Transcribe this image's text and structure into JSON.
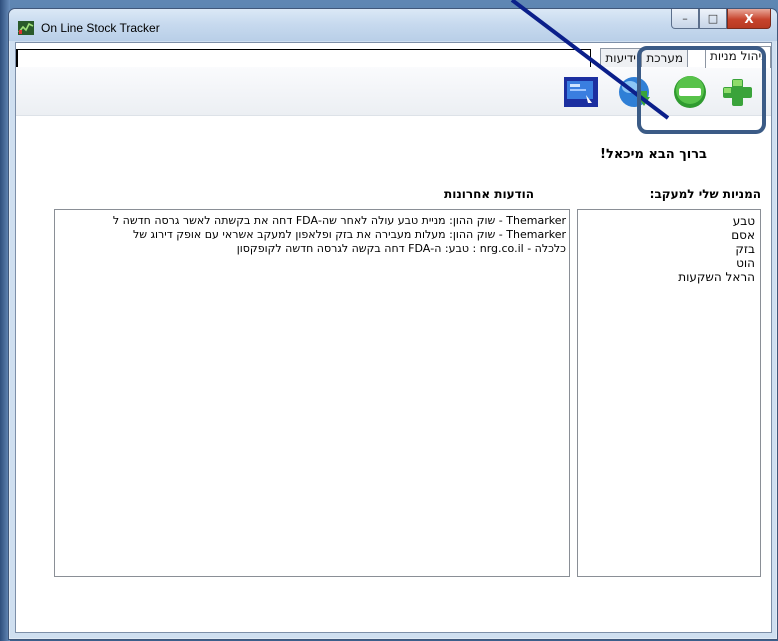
{
  "window": {
    "title": "On Line Stock Tracker"
  },
  "controls": {
    "minimize": "–",
    "maximize": "□",
    "close": "X"
  },
  "tabs": [
    {
      "label": "ניהול מניות",
      "active": true
    },
    {
      "label": "מערכת",
      "active": false
    },
    {
      "label": "ידיעות",
      "active": false
    }
  ],
  "toolbar": {
    "buttons": [
      {
        "name": "add-stock",
        "icon": "green-plus-icon"
      },
      {
        "name": "remove-stock",
        "icon": "green-minus-icon"
      },
      {
        "name": "refresh",
        "icon": "globe-arrow-icon"
      },
      {
        "name": "presentation",
        "icon": "screen-icon"
      }
    ]
  },
  "welcome": "ברוך הבא מיכאל!",
  "stocks": {
    "header": "המניות שלי למעקב:",
    "items": [
      "טבע",
      "אסם",
      "בזק",
      "הוט",
      "הראל השקעות"
    ]
  },
  "news": {
    "header": "הודעות אחרונות",
    "items": [
      "Themarker - שוק ההון: מניית טבע עולה לאחר שה-FDA דחה את בקשתה לאשר גרסה חדשה ל",
      "Themarker - שוק ההון: מעלות מעבירה את בזק ופלאפון למעקב אשראי עם אופק דירוג של",
      "כלכלה - nrg.co.il : טבע: ה-FDA דחה בקשה לגרסה חדשה לקופקסון"
    ]
  },
  "colors": {
    "accent": "#3b5b86",
    "arrow": "#0b1f8a",
    "close_button": "#c7432c",
    "icon_green": "#3aa33a"
  }
}
